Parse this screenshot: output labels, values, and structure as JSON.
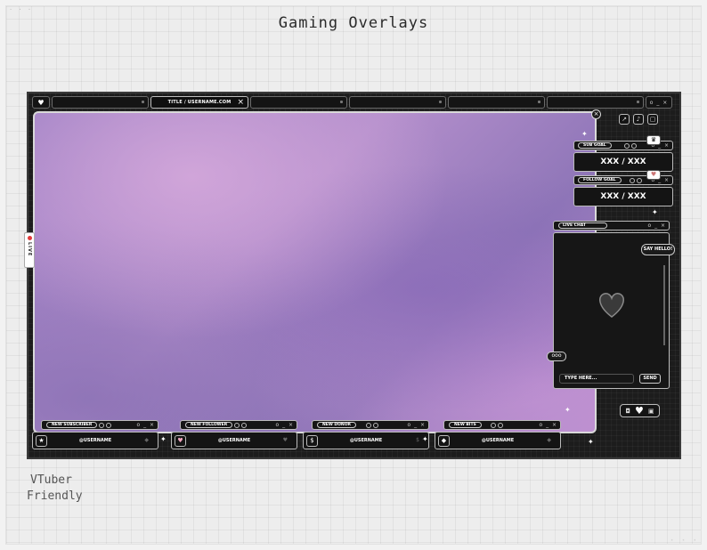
{
  "page": {
    "title": "Gaming Overlays",
    "caption_line1": "VTuber",
    "caption_line2": "Friendly"
  },
  "browser": {
    "active_tab_title": "TITLE / USERNAME.COM",
    "tab_close": "×",
    "window_controls": "o _ ×",
    "heart_icon": "♥"
  },
  "live_tag": "LIVE",
  "goals": [
    {
      "label": "SUB GOAL",
      "value": "XXX / XXX"
    },
    {
      "label": "FOLLOW GOAL",
      "value": "XXX / XXX"
    }
  ],
  "chat": {
    "label": "LIVE CHAT",
    "bubble": "SAY HELLO!",
    "typing": "ooo",
    "input_placeholder": "TYPE HERE...",
    "send": "SEND"
  },
  "alerts": [
    {
      "label": "NEW SUBSCRIBER",
      "user": "@USERNAME",
      "icon": "star-icon"
    },
    {
      "label": "NEW FOLLOWER",
      "user": "@USERNAME",
      "icon": "heart-icon"
    },
    {
      "label": "NEW DONOR",
      "user": "@USERNAME",
      "icon": "dollar-icon"
    },
    {
      "label": "NEW BITS",
      "user": "@USERNAME",
      "icon": "gem-icon"
    }
  ],
  "colors": {
    "frame": "#1c1c1c",
    "screen_purple": "#9d80c4",
    "accent_white": "#ffffff",
    "live_red": "#e23b3b"
  }
}
